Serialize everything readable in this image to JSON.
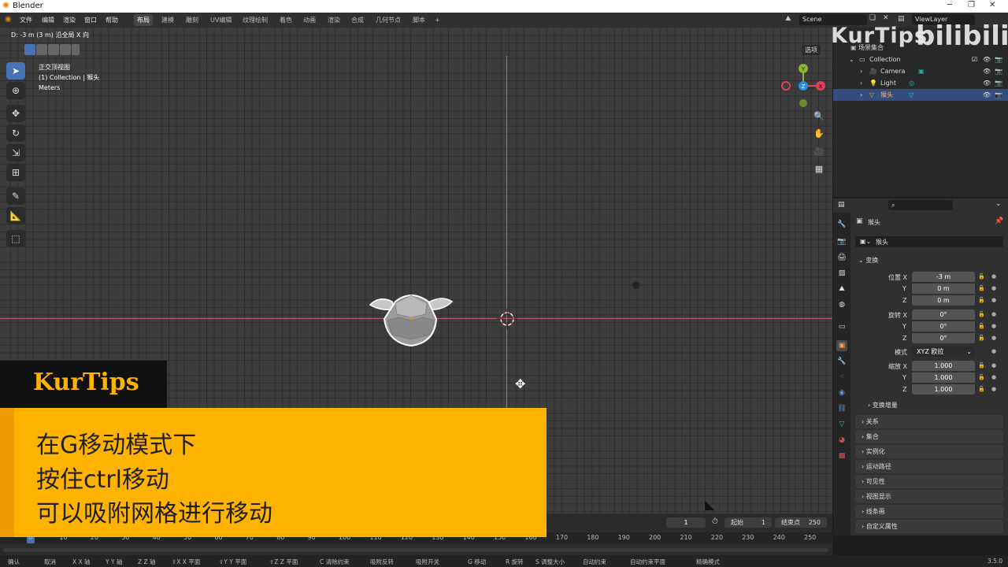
{
  "titlebar": {
    "app_title": "Blender",
    "min": "─",
    "max": "❐",
    "close": "✕"
  },
  "menubar": {
    "menus": [
      "文件",
      "编辑",
      "渲染",
      "窗口",
      "帮助"
    ],
    "workspaces": [
      "布局",
      "建模",
      "雕刻",
      "UV编辑",
      "纹理绘制",
      "着色",
      "动画",
      "渲染",
      "合成",
      "几何节点",
      "脚本"
    ],
    "add_tab": "+",
    "scene": "Scene",
    "view_layer": "ViewLayer"
  },
  "viewport": {
    "header_status": "D: -3 m (3 m) 沿全局 X 向",
    "overlay_lines": [
      "正交顶视图",
      "(1) Collection | 猴头",
      "Meters"
    ],
    "options_label": "选项",
    "gizmo": {
      "y": "Y",
      "z": "Z",
      "x": "X"
    }
  },
  "tools": [
    {
      "name": "select-box",
      "glyph": "➤"
    },
    {
      "name": "cursor",
      "glyph": "⊕"
    },
    {
      "name": "move",
      "glyph": "✥"
    },
    {
      "name": "rotate",
      "glyph": "↻"
    },
    {
      "name": "scale",
      "glyph": "⇲"
    },
    {
      "name": "transform",
      "glyph": "⊞"
    },
    {
      "name": "annotate",
      "glyph": "✎"
    },
    {
      "name": "measure",
      "glyph": "📐"
    },
    {
      "name": "add-cube",
      "glyph": "⬚"
    }
  ],
  "outliner": {
    "scene_collection": "场景集合",
    "collection": "Collection",
    "items": [
      {
        "label": "Camera"
      },
      {
        "label": "Light"
      },
      {
        "label": "猴头"
      }
    ]
  },
  "properties": {
    "search_icon": "⌕",
    "object_name": "猴头",
    "object_field": "猴头",
    "transform_header": "变换",
    "location": {
      "label_x": "位置 X",
      "x": "-3 m",
      "y": "0 m",
      "z": "0 m"
    },
    "rotation": {
      "label_x": "旋转 X",
      "x": "0°",
      "y": "0°",
      "z": "0°"
    },
    "mode_label": "模式",
    "mode_value": "XYZ 欧拉",
    "scale": {
      "label_x": "缩放 X",
      "x": "1.000",
      "y": "1.000",
      "z": "1.000"
    },
    "axis_y": "Y",
    "axis_z": "Z",
    "delta_transform": "变换增量",
    "sections": [
      "关系",
      "集合",
      "实例化",
      "运动路径",
      "可见性",
      "视图显示",
      "线条画",
      "自定义属性"
    ]
  },
  "timeline": {
    "current_frame": "1",
    "start_label": "起始",
    "start": "1",
    "end_label": "结束点",
    "end": "250",
    "ticks": [
      "0",
      "10",
      "20",
      "30",
      "40",
      "50",
      "60",
      "70",
      "80",
      "90",
      "100",
      "110",
      "120",
      "130",
      "140",
      "150",
      "160",
      "170",
      "180",
      "190",
      "200",
      "210",
      "220",
      "230",
      "240",
      "250"
    ]
  },
  "statusbar": {
    "items": [
      "确认",
      "取消",
      "X X 轴",
      "Y Y 轴",
      "Z Z 轴",
      "⇧X X 平面",
      "⇧Y Y 平面",
      "⇧Z Z 平面",
      "C 清除约束",
      "吸附反转",
      "吸附开关",
      "G 移动",
      "R 旋转",
      "S 调整大小",
      "自动约束",
      "自动约束平面",
      "精确模式"
    ],
    "version": "3.5.0"
  },
  "overlay": {
    "brand": "KurTips",
    "lines": [
      "在G移动模式下",
      "按住ctrl移动",
      "可以吸附网格进行移动"
    ]
  },
  "watermark": {
    "text": "KurTips",
    "logo": "bilibili"
  },
  "colors": {
    "overlay_yellow": "#feb300",
    "selection_blue": "#4772b3",
    "x_axis": "#e04060",
    "y_axis": "#8ab832",
    "z_axis": "#2b8de0"
  }
}
